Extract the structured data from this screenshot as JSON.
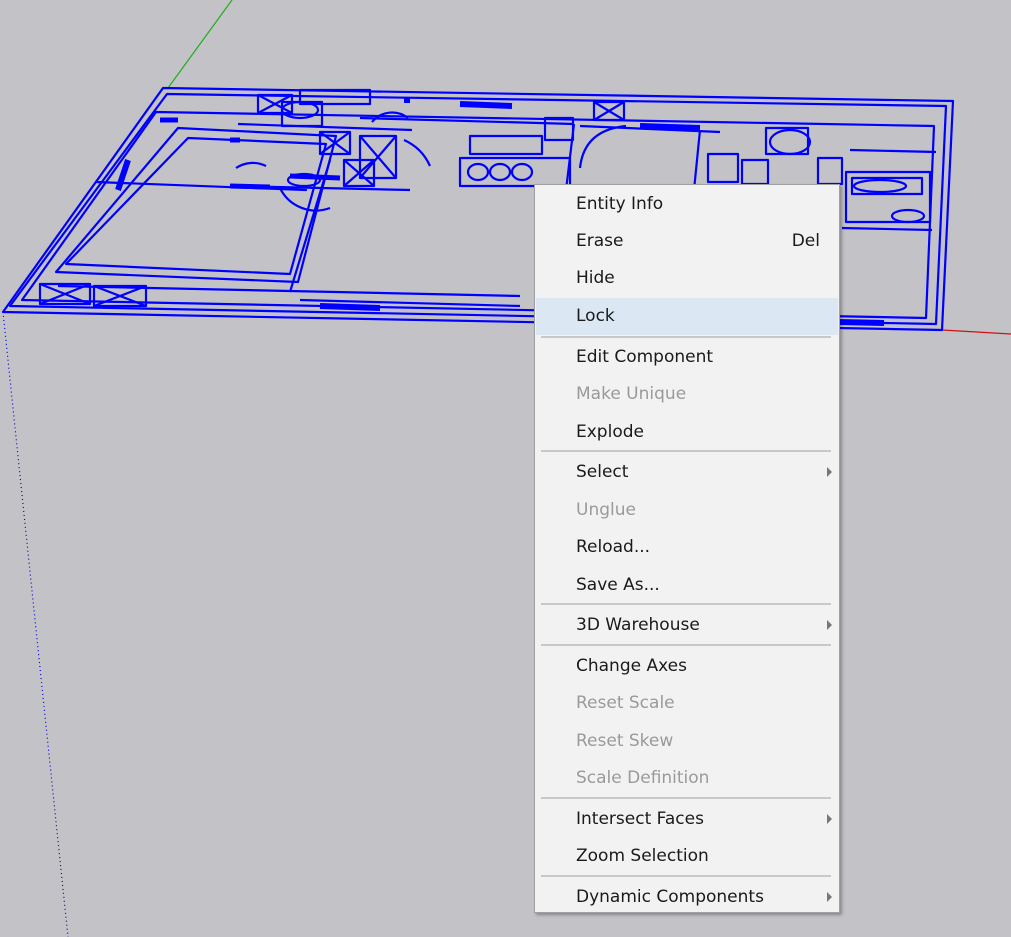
{
  "canvas": {
    "background": "#c3c3c7",
    "model_color": "#0000ff",
    "axis_green": "#1fae1f",
    "axis_red": "#d01010",
    "axis_blue": "#0000cc"
  },
  "context_menu": {
    "highlight_color": "#dbe8f4",
    "items": [
      {
        "label": "Entity Info",
        "enabled": true
      },
      {
        "label": "Erase",
        "shortcut": "Del",
        "enabled": true
      },
      {
        "label": "Hide",
        "enabled": true
      },
      {
        "label": "Lock",
        "enabled": true,
        "highlighted": true
      },
      {
        "label": "Edit Component",
        "enabled": true
      },
      {
        "label": "Make Unique",
        "enabled": false
      },
      {
        "label": "Explode",
        "enabled": true
      },
      {
        "label": "Select",
        "enabled": true,
        "submenu": true
      },
      {
        "label": "Unglue",
        "enabled": false
      },
      {
        "label": "Reload...",
        "enabled": true
      },
      {
        "label": "Save As...",
        "enabled": true
      },
      {
        "label": "3D Warehouse",
        "enabled": true,
        "submenu": true
      },
      {
        "label": "Change Axes",
        "enabled": true
      },
      {
        "label": "Reset Scale",
        "enabled": false
      },
      {
        "label": "Reset Skew",
        "enabled": false
      },
      {
        "label": "Scale Definition",
        "enabled": false
      },
      {
        "label": "Intersect Faces",
        "enabled": true,
        "submenu": true
      },
      {
        "label": "Zoom Selection",
        "enabled": true
      },
      {
        "label": "Dynamic Components",
        "enabled": true,
        "submenu": true
      }
    ]
  }
}
